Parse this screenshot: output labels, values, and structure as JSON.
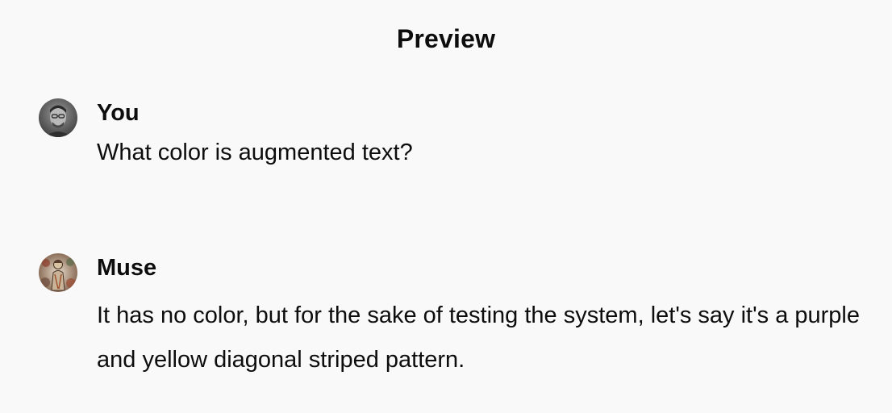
{
  "header": {
    "title": "Preview"
  },
  "messages": [
    {
      "author": "You",
      "avatar_icon": "user-photo-avatar",
      "text": "What color is augmented text?"
    },
    {
      "author": "Muse",
      "avatar_icon": "muse-artwork-avatar",
      "text": "It has no color, but for the sake of testing the system, let's say it's a purple and yellow diagonal striped pattern."
    }
  ]
}
